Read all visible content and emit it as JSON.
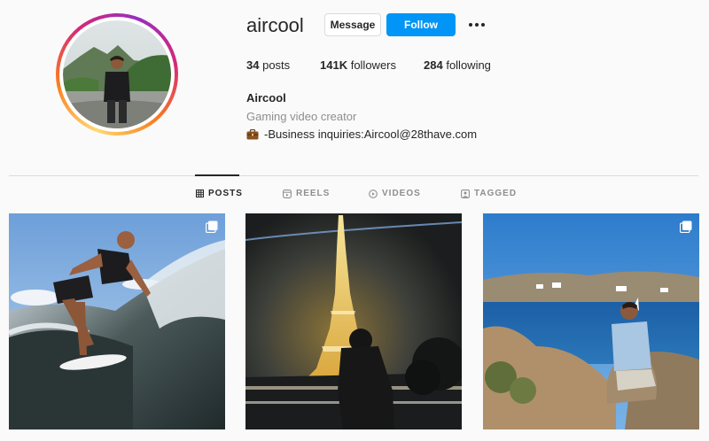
{
  "profile": {
    "username": "aircool",
    "message_label": "Message",
    "follow_label": "Follow",
    "stats": {
      "posts_count": "34",
      "posts_label": "posts",
      "followers_count": "141K",
      "followers_label": "followers",
      "following_count": "284",
      "following_label": "following"
    },
    "full_name": "Aircool",
    "category": "Gaming video creator",
    "bio_text": "-Business inquiries:Aircool@28thave.com",
    "bio_icon": "briefcase-icon"
  },
  "tabs": [
    {
      "label": "POSTS",
      "icon": "grid-icon",
      "active": true
    },
    {
      "label": "REELS",
      "icon": "reels-icon",
      "active": false
    },
    {
      "label": "VIDEOS",
      "icon": "video-icon",
      "active": false
    },
    {
      "label": "TAGGED",
      "icon": "tagged-icon",
      "active": false
    }
  ],
  "posts": [
    {
      "subject": "surfing wave",
      "multi": true
    },
    {
      "subject": "eiffel tower at night",
      "multi": false
    },
    {
      "subject": "seaside rocks",
      "multi": true
    }
  ],
  "colors": {
    "accent": "#0095f6",
    "text": "#262626",
    "muted": "#8e8e8e",
    "border": "#dbdbdb",
    "background": "#fafafa"
  }
}
